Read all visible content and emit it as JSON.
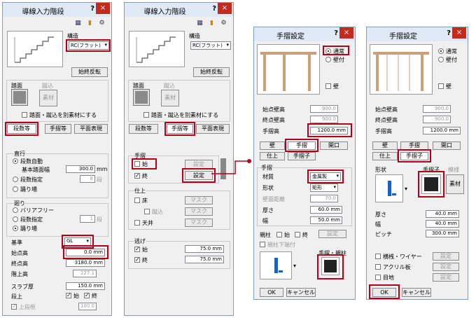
{
  "p1": {
    "title": "導線入力階段",
    "q": "?",
    "close": "×",
    "struct_label": "構造",
    "struct_value": "RC(フラット)",
    "reverse": "始終反転",
    "tread": "踏面",
    "riser": "蹴込",
    "material": "素材",
    "sep_check": "踏面・蹴込を別素材にする",
    "tabs": [
      "段数等",
      "手摺等",
      "平面表現"
    ],
    "straight": "直行",
    "auto": "段数自動",
    "base_tread": "基本踏面幅",
    "base_tread_val": "300.0",
    "mm": "mm",
    "count_spec": "段数指定",
    "count_val": "8",
    "steps_unit": "段",
    "landing": "踊り場",
    "turn": "廻り",
    "barrier": "バリアフリー",
    "count_spec2": "段数指定",
    "count_val2": "1",
    "steps_unit2": "段",
    "landing2": "踊り場",
    "base": "基準",
    "base_val": "GL",
    "start_h": "始点高",
    "start_val": "0.0 mm",
    "end_h": "終点高",
    "end_val": "3180.0 mm",
    "floor_h": "階上高",
    "floor_val": "227.1",
    "slab": "スラブ厚",
    "slab_val": "150.0 mm",
    "step": "段上",
    "start": "始",
    "end": "終",
    "upper": "上段框",
    "upper_val": "100.0"
  },
  "p2": {
    "title": "導線入力階段",
    "q": "?",
    "close": "×",
    "struct_label": "構造",
    "struct_value": "RC(フラット)",
    "reverse": "始終反転",
    "tread": "踏面",
    "riser": "蹴込",
    "material": "素材",
    "sep_check": "踏面・蹴込を別素材にする",
    "tabs": [
      "段数等",
      "手摺等",
      "平面表現"
    ],
    "handrail": "手摺",
    "start": "始",
    "end": "終",
    "setting": "設定",
    "setting2": "設定",
    "finish": "仕上",
    "floor": "床",
    "riser2": "蹴込",
    "ceiling": "天井",
    "mask": "マスク",
    "escape": "逃げ",
    "start_val": "75.0 mm",
    "end_val": "75.0 mm"
  },
  "p3": {
    "title": "手摺設定",
    "q": "?",
    "close": "×",
    "normal": "通常",
    "wall_attach": "壁付",
    "wall": "壁",
    "start_wall": "始点壁高",
    "start_wall_val": "900.0",
    "end_wall": "終点壁高",
    "end_wall_val": "900.0",
    "rail_h": "手摺高",
    "rail_h_val": "1200.0 mm",
    "tabs": [
      "壁",
      "手摺",
      "開口"
    ],
    "tabs2": [
      "仕上",
      "手摺子"
    ],
    "rail": "手摺",
    "mat": "材質",
    "mat_val": "金属製",
    "shape": "形状",
    "shape_val": "矩形",
    "wall_dist": "壁面距離",
    "wall_dist_val": "70.0",
    "thick": "厚さ",
    "thick_val": "60.0 mm",
    "width": "幅",
    "width_val": "50.0 mm",
    "newel": "親柱",
    "start": "始",
    "end": "終",
    "setting": "設定",
    "newel_low": "親柱下端付",
    "rail_newel": "手摺・親柱",
    "ok": "OK",
    "cancel": "キャンセル"
  },
  "p4": {
    "title": "手摺設定",
    "q": "?",
    "close": "×",
    "normal": "通常",
    "wall_attach": "壁付",
    "wall": "壁",
    "start_wall": "始点壁高",
    "start_wall_val": "900.0",
    "end_wall": "終点壁高",
    "end_wall_val": "900.0",
    "rail_h": "手摺高",
    "rail_h_val": "1200.0 mm",
    "tabs": [
      "壁",
      "手摺",
      "開口"
    ],
    "tabs2": [
      "仕上",
      "手摺子"
    ],
    "shape": "形状",
    "baluster": "手摺子",
    "pattern": "模様",
    "material": "素材",
    "thick": "厚さ",
    "thick_val": "40.0 mm",
    "width": "幅",
    "width_val": "40.0 mm",
    "pitch": "ピッチ",
    "pitch_val": "300.0 mm",
    "wire": "横桟・ワイヤー",
    "acrylic": "アクリル板",
    "joint": "目地",
    "setting": "設定",
    "ok": "OK",
    "cancel": "キャンセル"
  }
}
